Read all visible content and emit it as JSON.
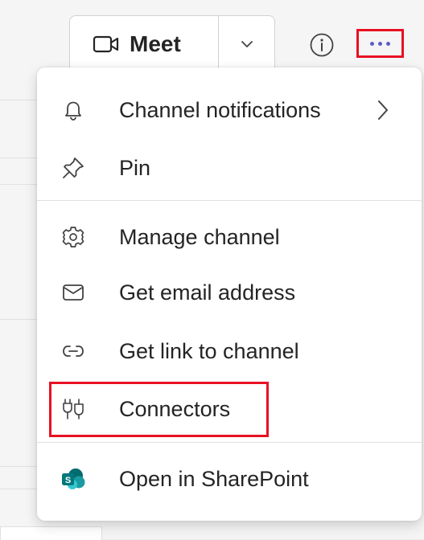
{
  "toolbar": {
    "meet_label": "Meet",
    "meet_icon": "video-camera-icon",
    "dropdown_icon": "chevron-down-icon",
    "info_icon": "info-icon",
    "more_icon": "more-options-icon"
  },
  "menu": {
    "items": [
      {
        "label": "Channel notifications",
        "icon": "bell-icon",
        "has_submenu": true
      },
      {
        "label": "Pin",
        "icon": "pin-icon"
      },
      {
        "label": "Manage channel",
        "icon": "gear-icon"
      },
      {
        "label": "Get email address",
        "icon": "mail-icon"
      },
      {
        "label": "Get link to channel",
        "icon": "link-icon"
      },
      {
        "label": "Connectors",
        "icon": "plug-icon"
      },
      {
        "label": "Open in SharePoint",
        "icon": "sharepoint-icon"
      }
    ]
  },
  "colors": {
    "accent": "#5b5fc7",
    "highlight": "#e81123",
    "sharepoint": "#036c70"
  }
}
